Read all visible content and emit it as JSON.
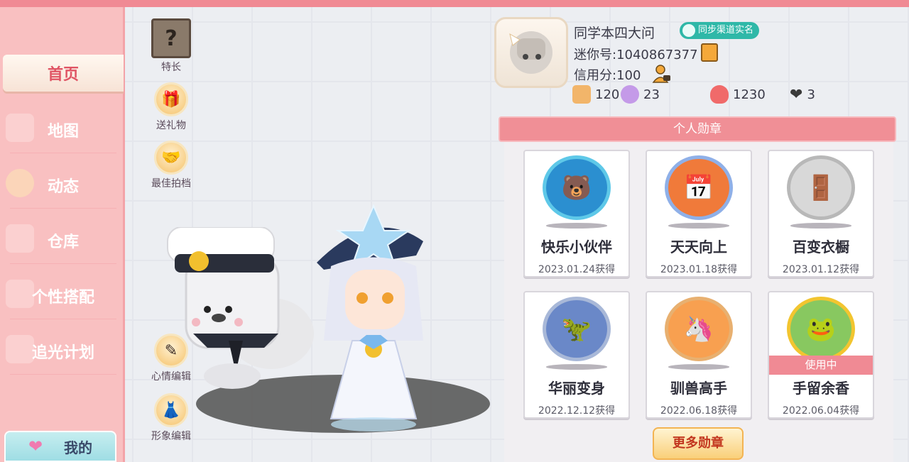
{
  "nav": {
    "items": [
      {
        "label": "首页",
        "active": true
      },
      {
        "label": "地图"
      },
      {
        "label": "动态"
      },
      {
        "label": "仓库"
      },
      {
        "label": "个性搭配"
      },
      {
        "label": "追光计划"
      }
    ],
    "mine_label": "我的"
  },
  "actions": {
    "talent": "特长",
    "gift": "送礼物",
    "partner": "最佳拍档",
    "mood_edit": "心情编辑",
    "look_edit": "形象编辑"
  },
  "profile": {
    "name": "同学本四大问",
    "verify_badge": "同步渠道实名",
    "mini_id": "迷你号:1040867377",
    "credit": "信用分:100",
    "stats": [
      {
        "icon": "plus-flag-icon",
        "value": "120",
        "color": "#f2b56a"
      },
      {
        "icon": "cheer-icon",
        "value": "23",
        "color": "#c49ae8"
      },
      {
        "icon": "flame-icon",
        "value": "1230",
        "color": "#f06a6a"
      },
      {
        "icon": "hearts-icon",
        "value": "3",
        "color": "#3a3a3a"
      }
    ]
  },
  "medals": {
    "header": "个人勋章",
    "items": [
      {
        "name": "快乐小伙伴",
        "date": "2023.01.24获得",
        "ring": "#5ec8e8",
        "fill": "#2b8fd0",
        "glyph": "🐻"
      },
      {
        "name": "天天向上",
        "date": "2023.01.18获得",
        "ring": "#8fb0e8",
        "fill": "#f07a3a",
        "glyph": "📅"
      },
      {
        "name": "百变衣橱",
        "date": "2023.01.12获得",
        "ring": "#b8b8b8",
        "fill": "#d8d8d8",
        "glyph": "🚪"
      },
      {
        "name": "华丽变身",
        "date": "2022.12.12获得",
        "ring": "#a8b8d8",
        "fill": "#6a88c8",
        "glyph": "🦖"
      },
      {
        "name": "驯兽高手",
        "date": "2022.06.18获得",
        "ring": "#e8b070",
        "fill": "#f8a050",
        "glyph": "🦄"
      },
      {
        "name": "手留余香",
        "date": "2022.06.04获得",
        "ring": "#f2c530",
        "fill": "#88c860",
        "glyph": "🐸",
        "in_use": "使用中"
      }
    ],
    "more_label": "更多勋章"
  }
}
